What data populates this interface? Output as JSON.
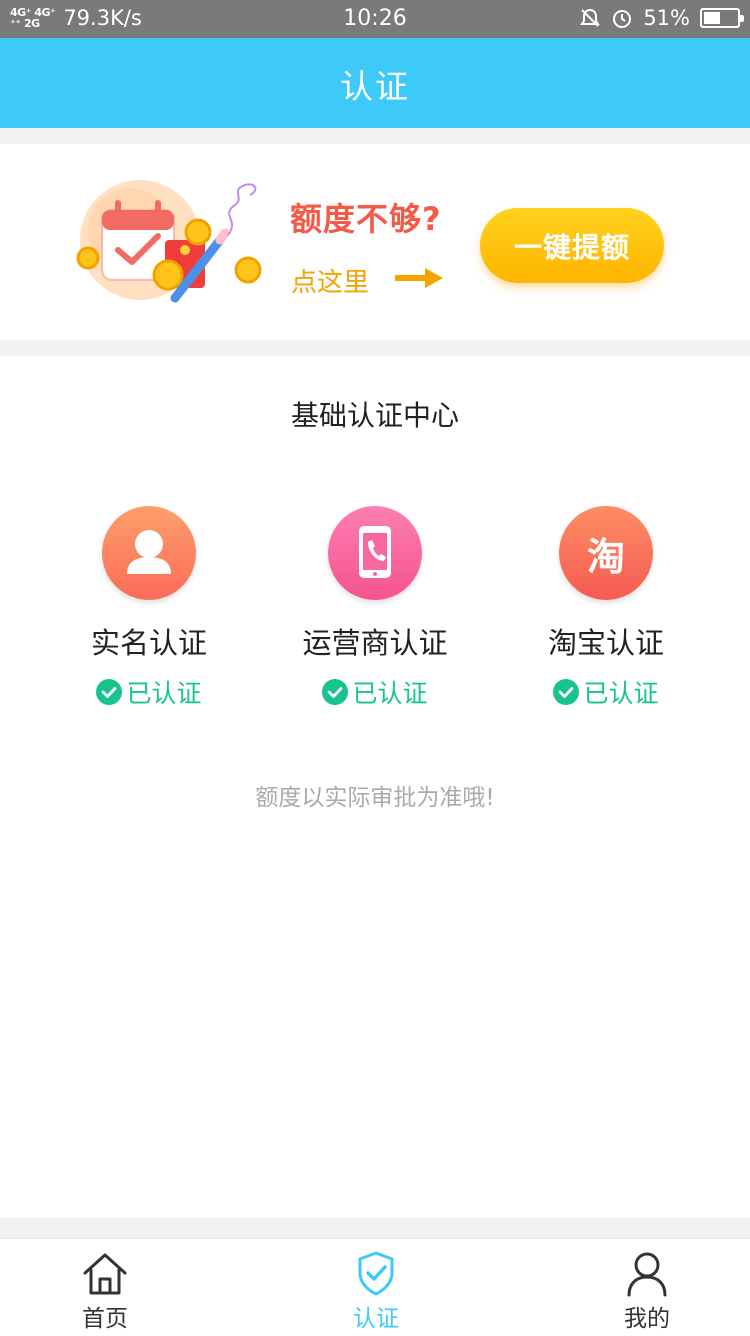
{
  "status_bar": {
    "network_top": "4G⁺ 4G⁺",
    "network_bottom": "⁺⁺ 2G",
    "speed": "79.3K/s",
    "time": "10:26",
    "battery": "51%",
    "battery_level": 0.51
  },
  "header": {
    "title": "认证"
  },
  "banner": {
    "question": "额度不够?",
    "hint": "点这里",
    "button_label": "一键提额"
  },
  "main": {
    "section_title": "基础认证中心",
    "items": [
      {
        "label": "实名认证",
        "status": "已认证",
        "icon": "user-icon",
        "color_top": "#fda06a",
        "color_bottom": "#fb6b5a"
      },
      {
        "label": "运营商认证",
        "status": "已认证",
        "icon": "phone-icon",
        "color_top": "#fd7fb2",
        "color_bottom": "#f5538f"
      },
      {
        "label": "淘宝认证",
        "status": "已认证",
        "icon": "taobao-icon",
        "icon_text": "淘",
        "color_top": "#fd8e62",
        "color_bottom": "#f65a55"
      }
    ],
    "footnote": "额度以实际审批为准哦!"
  },
  "tab_bar": {
    "tabs": [
      {
        "label": "首页",
        "icon": "home-icon",
        "active": false
      },
      {
        "label": "认证",
        "icon": "shield-check-icon",
        "active": true
      },
      {
        "label": "我的",
        "icon": "person-icon",
        "active": false
      }
    ]
  },
  "colors": {
    "accent": "#3dcaf9",
    "success": "#17c490",
    "button": "#ffc20e",
    "question": "#f45a47",
    "hint": "#f5a300"
  }
}
